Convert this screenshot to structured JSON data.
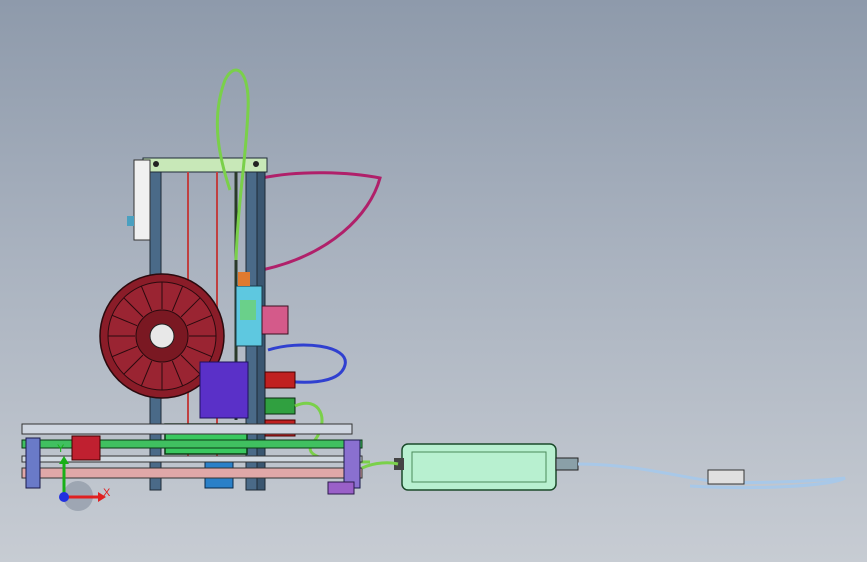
{
  "view": {
    "background_top": "#8e9aab",
    "background_bottom": "#c7ccd3"
  },
  "triad": {
    "x_label": "X",
    "y_label": "Y",
    "x_color": "#e02020",
    "y_color": "#18b018",
    "z_color": "#2030e0"
  },
  "model": {
    "frame_color": "#4a6a88",
    "spool_color": "#8a1c28",
    "filament_color": "#b0206a",
    "tube_green": "#7ad04a",
    "tube_blue": "#3040d0",
    "psu_color": "#b8f0d0",
    "cable_color": "#a8c8e8",
    "electronics_color": "#5a30c8"
  }
}
